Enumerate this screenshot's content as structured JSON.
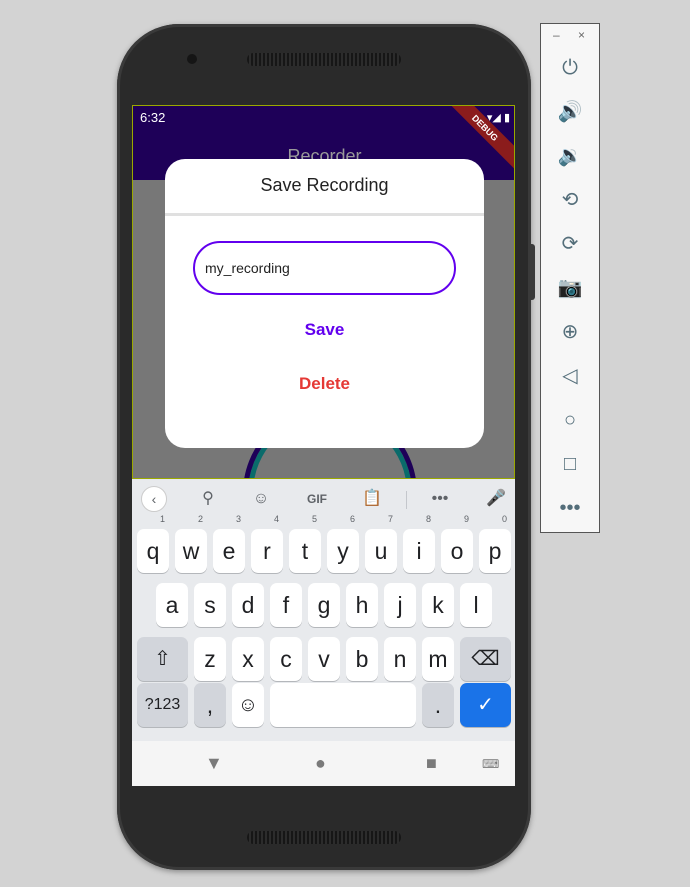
{
  "emulator_panel": {
    "minimize": "–",
    "close": "×",
    "buttons": [
      "power-icon",
      "volume-up-icon",
      "volume-down-icon",
      "rotate-left-icon",
      "rotate-right-icon",
      "camera-icon",
      "zoom-icon",
      "back-icon",
      "home-icon",
      "overview-icon",
      "more-icon"
    ]
  },
  "status_bar": {
    "time": "6:32"
  },
  "app": {
    "title": "Recorder",
    "debug_banner": "DEBUG"
  },
  "dialog": {
    "title": "Save Recording",
    "input_value": "my_recording",
    "save_label": "Save",
    "delete_label": "Delete"
  },
  "keyboard": {
    "toolbar": [
      "back",
      "search",
      "sticker",
      "GIF",
      "clipboard",
      "more",
      "mic"
    ],
    "gif_label": "GIF",
    "row1": [
      {
        "k": "q",
        "h": "1"
      },
      {
        "k": "w",
        "h": "2"
      },
      {
        "k": "e",
        "h": "3"
      },
      {
        "k": "r",
        "h": "4"
      },
      {
        "k": "t",
        "h": "5"
      },
      {
        "k": "y",
        "h": "6"
      },
      {
        "k": "u",
        "h": "7"
      },
      {
        "k": "i",
        "h": "8"
      },
      {
        "k": "o",
        "h": "9"
      },
      {
        "k": "p",
        "h": "0"
      }
    ],
    "row2": [
      "a",
      "s",
      "d",
      "f",
      "g",
      "h",
      "j",
      "k",
      "l"
    ],
    "row3": [
      "z",
      "x",
      "c",
      "v",
      "b",
      "n",
      "m"
    ],
    "symbols_label": "?123",
    "comma": ",",
    "period": "."
  },
  "colors": {
    "accent": "#6200ee",
    "danger": "#e53935",
    "appbar": "#1e0058",
    "enter": "#1a73e8"
  }
}
